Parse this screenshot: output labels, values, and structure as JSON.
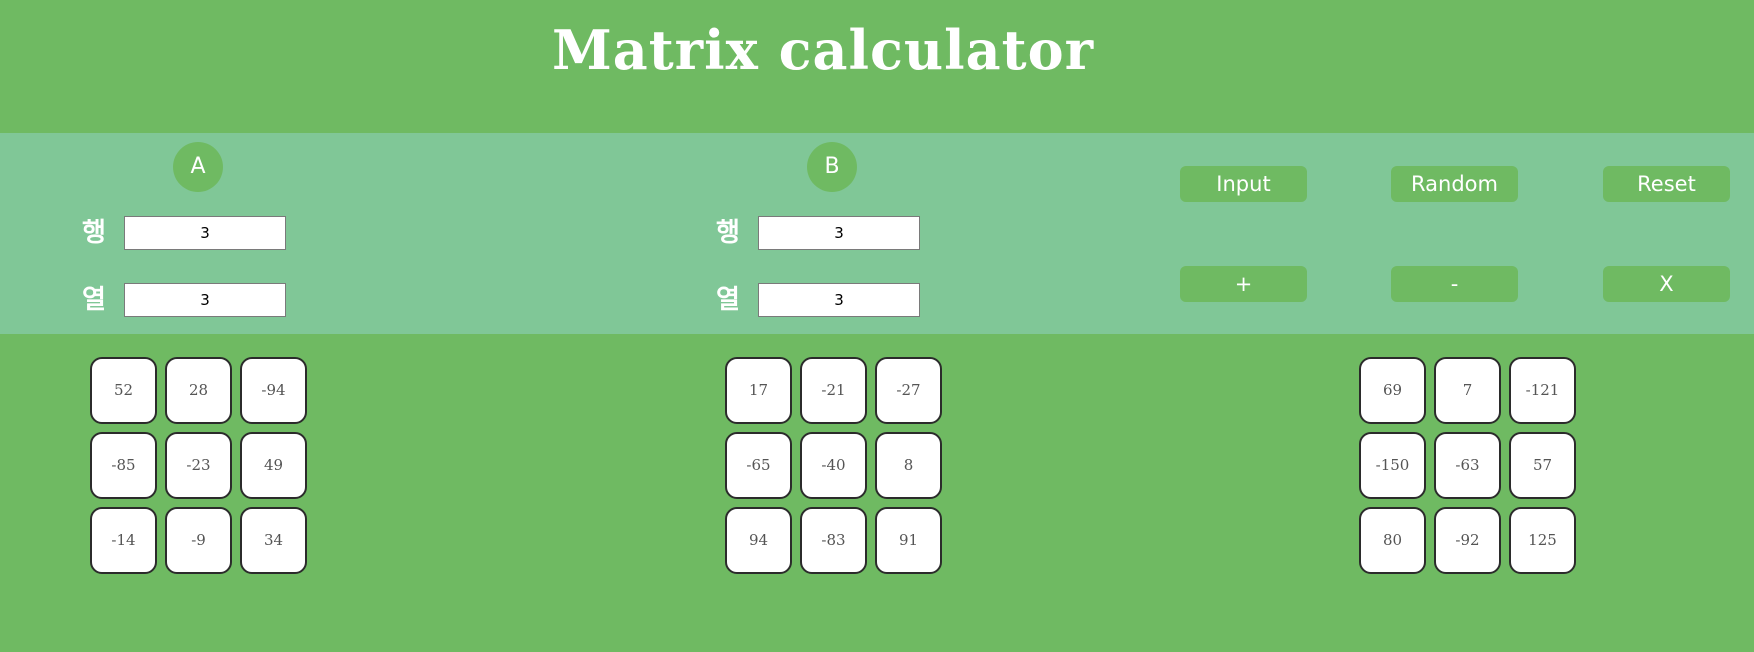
{
  "title": "Matrix calculator",
  "colors": {
    "background": "#6fba62",
    "control_band": "#80c797",
    "button": "#6fba62",
    "cell_background": "#ffffff",
    "cell_border": "#2b2b2b",
    "text_light": "#ffffff"
  },
  "matrix_a": {
    "label": "A",
    "rows_label": "행",
    "cols_label": "열",
    "rows_value": "3",
    "cols_value": "3"
  },
  "matrix_b": {
    "label": "B",
    "rows_label": "행",
    "cols_label": "열",
    "rows_value": "3",
    "cols_value": "3"
  },
  "buttons": {
    "input": "Input",
    "random": "Random",
    "reset": "Reset",
    "add": "+",
    "subtract": "-",
    "multiply": "X"
  },
  "grids": {
    "a": [
      [
        "52",
        "28",
        "-94"
      ],
      [
        "-85",
        "-23",
        "49"
      ],
      [
        "-14",
        "-9",
        "34"
      ]
    ],
    "b": [
      [
        "17",
        "-21",
        "-27"
      ],
      [
        "-65",
        "-40",
        "8"
      ],
      [
        "94",
        "-83",
        "91"
      ]
    ],
    "result": [
      [
        "69",
        "7",
        "-121"
      ],
      [
        "-150",
        "-63",
        "57"
      ],
      [
        "80",
        "-92",
        "125"
      ]
    ]
  }
}
